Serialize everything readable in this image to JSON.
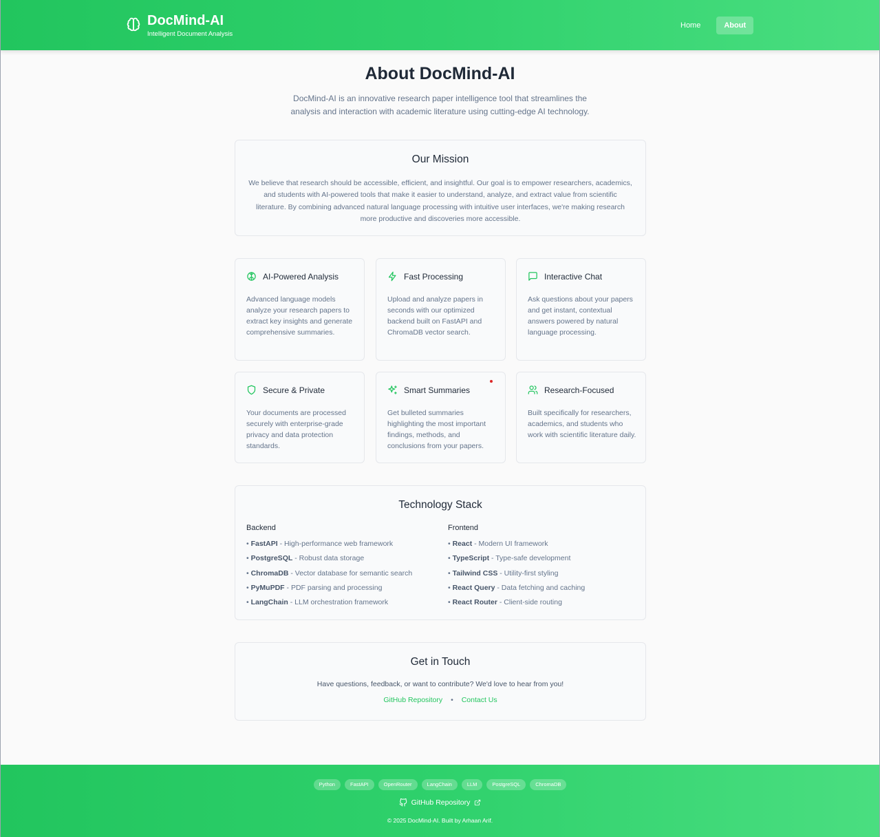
{
  "header": {
    "brand_icon": "brain-icon",
    "title": "DocMind-AI",
    "subtitle": "Intelligent Document Analysis",
    "nav": [
      {
        "label": "Home",
        "active": false
      },
      {
        "label": "About",
        "active": true
      }
    ],
    "accent": "#22c55e"
  },
  "hero": {
    "title": "About DocMind-AI",
    "description": "DocMind-AI is an innovative research paper intelligence tool that streamlines the analysis and interaction with academic literature using cutting-edge AI technology."
  },
  "mission": {
    "title": "Our Mission",
    "text": "We believe that research should be accessible, efficient, and insightful. Our goal is to empower researchers, academics, and students with AI-powered tools that make it easier to understand, analyze, and extract value from scientific literature. By combining advanced natural language processing with intuitive user interfaces, we're making research more productive and discoveries more accessible."
  },
  "features": [
    {
      "icon": "brain-icon",
      "title": "AI-Powered Analysis",
      "desc": "Advanced language models analyze your research papers to extract key insights and generate comprehensive summaries."
    },
    {
      "icon": "zap-icon",
      "title": "Fast Processing",
      "desc": "Upload and analyze papers in seconds with our optimized backend built on FastAPI and ChromaDB vector search."
    },
    {
      "icon": "chat-icon",
      "title": "Interactive Chat",
      "desc": "Ask questions about your papers and get instant, contextual answers powered by natural language processing."
    },
    {
      "icon": "shield-icon",
      "title": "Secure & Private",
      "desc": "Your documents are processed securely with enterprise-grade privacy and data protection standards."
    },
    {
      "icon": "sparkles-icon",
      "title": "Smart Summaries",
      "desc": "Get bulleted summaries highlighting the most important findings, methods, and conclusions from your papers."
    },
    {
      "icon": "users-icon",
      "title": "Research-Focused",
      "desc": "Built specifically for researchers, academics, and students who work with scientific literature daily."
    }
  ],
  "tech": {
    "title": "Technology Stack",
    "backend": {
      "heading": "Backend",
      "items": [
        {
          "name": "FastAPI",
          "desc": " - High-performance web framework"
        },
        {
          "name": "PostgreSQL",
          "desc": " - Robust data storage"
        },
        {
          "name": "ChromaDB",
          "desc": " - Vector database for semantic search"
        },
        {
          "name": "PyMuPDF",
          "desc": " - PDF parsing and processing"
        },
        {
          "name": "LangChain",
          "desc": " - LLM orchestration framework"
        }
      ]
    },
    "frontend": {
      "heading": "Frontend",
      "items": [
        {
          "name": "React",
          "desc": " - Modern UI framework"
        },
        {
          "name": "TypeScript",
          "desc": " - Type-safe development"
        },
        {
          "name": "Tailwind CSS",
          "desc": " - Utility-first styling"
        },
        {
          "name": "React Query",
          "desc": " - Data fetching and caching"
        },
        {
          "name": "React Router",
          "desc": " - Client-side routing"
        }
      ]
    }
  },
  "contact": {
    "title": "Get in Touch",
    "text": "Have questions, feedback, or want to contribute? We'd love to hear from you!",
    "github_link": "GitHub Repository",
    "separator": "•",
    "contact_link": "Contact Us"
  },
  "footer": {
    "tags": [
      "Python",
      "FastAPI",
      "OpenRouter",
      "LangChain",
      "LLM",
      "PostgreSQL",
      "ChromaDB"
    ],
    "github_label": "GitHub Repository",
    "github_icon": "github-icon",
    "external_icon": "external-link-icon",
    "copyright": "© 2025 DocMind-AI. Built by Arhaan Arif."
  }
}
